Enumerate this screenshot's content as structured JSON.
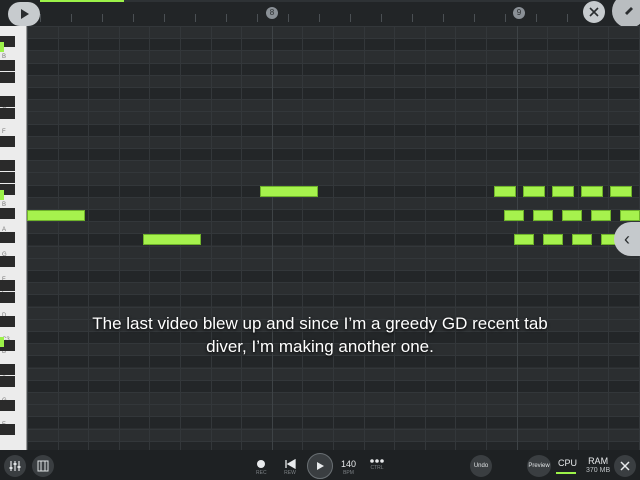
{
  "caption": {
    "line1": "The last video blew up and since I’m a greedy GD recent tab",
    "line2": "diver, I’m making another one."
  },
  "top": {
    "playback_progress": 0.15,
    "marker_1": "8",
    "marker_2": "9"
  },
  "keyboard": {
    "labels": [
      "C5",
      "B",
      "A",
      "G",
      "F",
      "E",
      "D",
      "C4",
      "B",
      "A",
      "G",
      "F",
      "E",
      "D",
      "C3",
      "B",
      "A",
      "G",
      "F"
    ]
  },
  "bottom": {
    "tempo_value": "140",
    "tempo_unit": "BPM",
    "rec_label": "REC",
    "rew_label": "REW",
    "ctrl_label": "CTRL",
    "undo_label": "Undo",
    "preview_label": "Preview",
    "cpu_label": "CPU",
    "ram_label": "RAM",
    "ram_value": "370 MB"
  },
  "colors": {
    "note": "#a6f24d",
    "accent": "#9cf249",
    "background": "#26292b"
  },
  "icons": {
    "play_top": "play-icon",
    "close_top": "close-icon",
    "side": "chevron-left-icon",
    "mixer": "mixer-icon",
    "piano_settings": "piano-settings-icon",
    "record": "record-dot-icon",
    "rewind": "skip-back-icon",
    "transport": "play-icon",
    "more": "more-dots-icon",
    "close_bottom": "close-icon"
  }
}
